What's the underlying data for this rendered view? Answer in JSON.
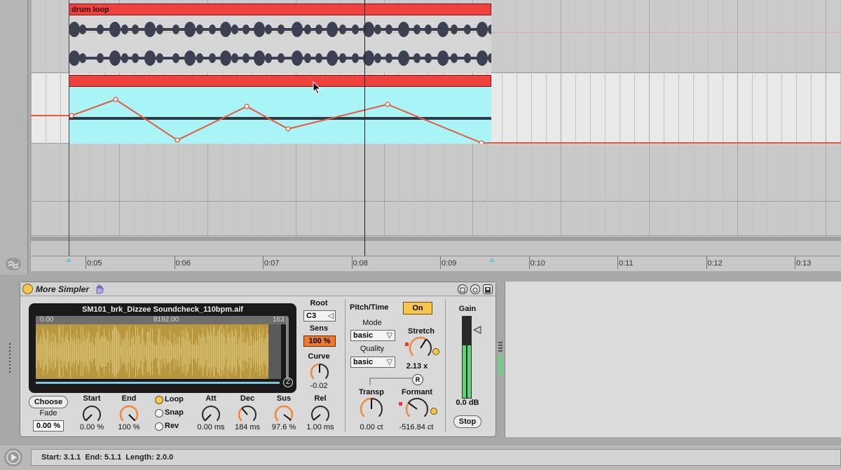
{
  "arrangement": {
    "clip_name": "drum loop",
    "timeline_ticks": [
      "0:05",
      "0:06",
      "0:07",
      "0:08",
      "0:09",
      "0:10",
      "0:11",
      "0:12",
      "0:13"
    ]
  },
  "device": {
    "name": "More Simpler",
    "sample_file": "SM101_brk_Dizzee Soundcheck_110bpm.aif",
    "wave_ruler": {
      "left": "0.00",
      "mid": "8192.00",
      "right": "163"
    },
    "root_label": "Root",
    "root_value": "C3",
    "sens_label": "Sens",
    "sens_value": "100 %",
    "curve_label": "Curve",
    "curve_value": "-0.02",
    "choose_button": "Choose",
    "fade_label": "Fade",
    "fade_value": "0.00 %",
    "start_label": "Start",
    "start_value": "0.00 %",
    "end_label": "End",
    "end_value": "100 %",
    "loop_label": "Loop",
    "snap_label": "Snap",
    "rev_label": "Rev",
    "att_label": "Att",
    "att_value": "0.00 ms",
    "dec_label": "Dec",
    "dec_value": "184 ms",
    "sus_label": "Sus",
    "sus_value": "97.6 %",
    "rel_label": "Rel",
    "rel_value": "1.00 ms",
    "pitchtime_label": "Pitch/Time",
    "on_button": "On",
    "mode_label": "Mode",
    "mode_value": "basic",
    "quality_label": "Quality",
    "quality_value": "basic",
    "stretch_label": "Stretch",
    "stretch_value": "2.13 x",
    "r_label": "R",
    "transp_label": "Transp",
    "transp_value": "0.00 ct",
    "formant_label": "Formant",
    "formant_value": "-516.84 ct",
    "gain_label": "Gain",
    "gain_value": "0.0 dB",
    "stop_button": "Stop"
  },
  "status": {
    "text": "Start: 3.1.1  End: 5.1.1  Length: 2.0.0"
  },
  "colors": {
    "clip_red": "#f1413f",
    "automation_cyan": "#a9f4f6",
    "automation_line": "#e8583e",
    "knob_orange": "#f08a3c",
    "waveform_gold": "#b8973f",
    "on_yellow": "#f7c64a",
    "sens_orange": "#f07a2a"
  }
}
